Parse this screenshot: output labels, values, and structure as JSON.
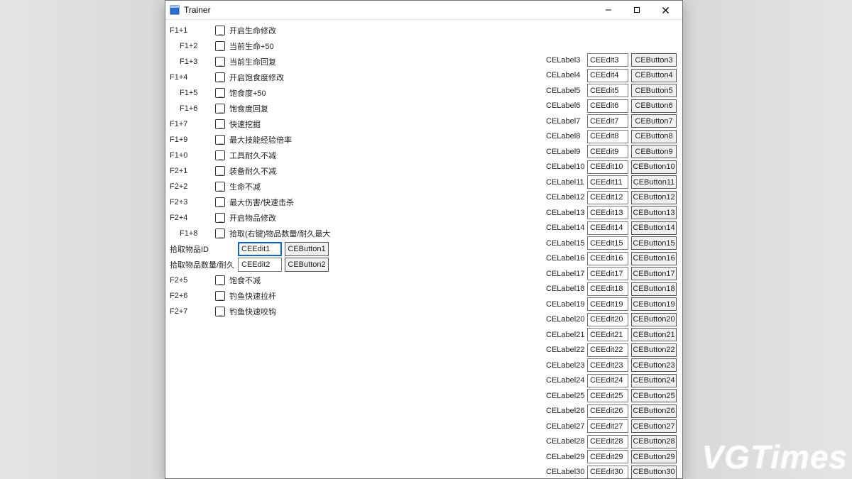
{
  "window": {
    "title": "Trainer"
  },
  "hotkeys": [
    {
      "key": "F1+1",
      "label": "开启生命修改",
      "indent": false
    },
    {
      "key": "F1+2",
      "label": "当前生命+50",
      "indent": true
    },
    {
      "key": "F1+3",
      "label": "当前生命回复",
      "indent": true
    },
    {
      "key": "F1+4",
      "label": "开启饱食度修改",
      "indent": false
    },
    {
      "key": "F1+5",
      "label": "饱食度+50",
      "indent": true
    },
    {
      "key": "F1+6",
      "label": "饱食度回复",
      "indent": true
    },
    {
      "key": "F1+7",
      "label": "快速挖掘",
      "indent": false
    },
    {
      "key": "F1+9",
      "label": "最大技能经验倍率",
      "indent": false
    },
    {
      "key": "F1+0",
      "label": "工具耐久不减",
      "indent": false
    },
    {
      "key": "F2+1",
      "label": "装备耐久不减",
      "indent": false
    },
    {
      "key": "F2+2",
      "label": "生命不减",
      "indent": false
    },
    {
      "key": "F2+3",
      "label": "最大伤害/快速击杀",
      "indent": false
    },
    {
      "key": "F2+4",
      "label": "开启物品修改",
      "indent": false
    },
    {
      "key": "F1+8",
      "label": "拾取(右键)物品数量/耐久最大",
      "indent": true
    }
  ],
  "pickup": {
    "row1": {
      "label": "拾取物品ID",
      "edit": "CEEdit1",
      "button": "CEButton1"
    },
    "row2": {
      "label": "拾取物品数量/耐久",
      "edit": "CEEdit2",
      "button": "CEButton2"
    }
  },
  "hotkeys_lower": [
    {
      "key": "F2+5",
      "label": "饱食不减"
    },
    {
      "key": "F2+6",
      "label": "钓鱼快速拉杆"
    },
    {
      "key": "F2+7",
      "label": "钓鱼快速咬钩"
    }
  ],
  "ce_rows": [
    {
      "label": "CELabel3",
      "edit": "CEEdit3",
      "button": "CEButton3"
    },
    {
      "label": "CELabel4",
      "edit": "CEEdit4",
      "button": "CEButton4"
    },
    {
      "label": "CELabel5",
      "edit": "CEEdit5",
      "button": "CEButton5"
    },
    {
      "label": "CELabel6",
      "edit": "CEEdit6",
      "button": "CEButton6"
    },
    {
      "label": "CELabel7",
      "edit": "CEEdit7",
      "button": "CEButton7"
    },
    {
      "label": "CELabel8",
      "edit": "CEEdit8",
      "button": "CEButton8"
    },
    {
      "label": "CELabel9",
      "edit": "CEEdit9",
      "button": "CEButton9"
    },
    {
      "label": "CELabel10",
      "edit": "CEEdit10",
      "button": "CEButton10"
    },
    {
      "label": "CELabel11",
      "edit": "CEEdit11",
      "button": "CEButton11"
    },
    {
      "label": "CELabel12",
      "edit": "CEEdit12",
      "button": "CEButton12"
    },
    {
      "label": "CELabel13",
      "edit": "CEEdit13",
      "button": "CEButton13"
    },
    {
      "label": "CELabel14",
      "edit": "CEEdit14",
      "button": "CEButton14"
    },
    {
      "label": "CELabel15",
      "edit": "CEEdit15",
      "button": "CEButton15"
    },
    {
      "label": "CELabel16",
      "edit": "CEEdit16",
      "button": "CEButton16"
    },
    {
      "label": "CELabel17",
      "edit": "CEEdit17",
      "button": "CEButton17"
    },
    {
      "label": "CELabel18",
      "edit": "CEEdit18",
      "button": "CEButton18"
    },
    {
      "label": "CELabel19",
      "edit": "CEEdit19",
      "button": "CEButton19"
    },
    {
      "label": "CELabel20",
      "edit": "CEEdit20",
      "button": "CEButton20"
    },
    {
      "label": "CELabel21",
      "edit": "CEEdit21",
      "button": "CEButton21"
    },
    {
      "label": "CELabel22",
      "edit": "CEEdit22",
      "button": "CEButton22"
    },
    {
      "label": "CELabel23",
      "edit": "CEEdit23",
      "button": "CEButton23"
    },
    {
      "label": "CELabel24",
      "edit": "CEEdit24",
      "button": "CEButton24"
    },
    {
      "label": "CELabel25",
      "edit": "CEEdit25",
      "button": "CEButton25"
    },
    {
      "label": "CELabel26",
      "edit": "CEEdit26",
      "button": "CEButton26"
    },
    {
      "label": "CELabel27",
      "edit": "CEEdit27",
      "button": "CEButton27"
    },
    {
      "label": "CELabel28",
      "edit": "CEEdit28",
      "button": "CEButton28"
    },
    {
      "label": "CELabel29",
      "edit": "CEEdit29",
      "button": "CEButton29"
    },
    {
      "label": "CELabel30",
      "edit": "CEEdit30",
      "button": "CEButton30"
    }
  ],
  "watermark": "VGTimes"
}
